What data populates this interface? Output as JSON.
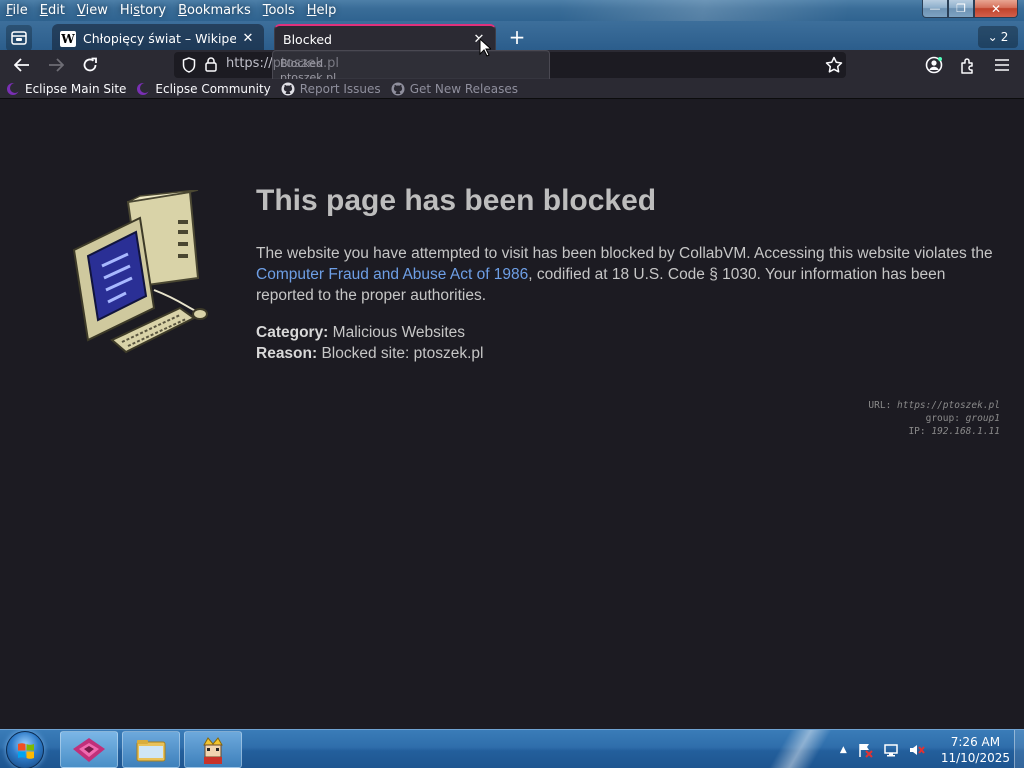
{
  "menu": {
    "file": {
      "u": "F",
      "rest": "ile"
    },
    "edit": {
      "u": "E",
      "rest": "dit"
    },
    "view": {
      "u": "V",
      "rest": "iew"
    },
    "history": {
      "pre": "Hi",
      "u": "s",
      "rest": "tory"
    },
    "bookmarks": {
      "u": "B",
      "rest": "ookmarks"
    },
    "tools": {
      "u": "T",
      "rest": "ools"
    },
    "help": {
      "u": "H",
      "rest": "elp"
    }
  },
  "window_controls": {
    "minimize": "—",
    "maximize": "❐",
    "close": "✕"
  },
  "tabs": [
    {
      "title": "Chłopięcy świat – Wikipedia, wo",
      "favicon": "W",
      "close": "✕",
      "active": false
    },
    {
      "title": "Blocked",
      "close": "✕",
      "active": true
    }
  ],
  "new_tab_label": "+",
  "tab_list_count": "2",
  "urlbar": {
    "url": "https://ptoszek.pl"
  },
  "url_popup": {
    "line1": "Blocked",
    "line2": "ptoszek.pl"
  },
  "bookmarks": [
    {
      "label": "Eclipse Main Site",
      "icon": "eclipse-icon",
      "dim": false
    },
    {
      "label": "Eclipse Community",
      "icon": "eclipse-icon",
      "dim": false
    },
    {
      "label": "Report Issues",
      "icon": "github-icon",
      "dim": true
    },
    {
      "label": "Get New Releases",
      "icon": "github-icon",
      "dim": true
    }
  ],
  "page": {
    "title": "This page has been blocked",
    "message_before": "The website you have attempted to visit has been blocked by CollabVM. Accessing this website violates the ",
    "message_link": "Computer Fraud and Abuse Act of 1986",
    "message_after": ", codified at 18 U.S. Code § 1030. Your information has been reported to the proper authorities.",
    "category_label": "Category:",
    "category_value": "Malicious Websites",
    "reason_label": "Reason:",
    "reason_value": "Blocked site: ptoszek.pl",
    "debug": {
      "url_label": "URL:",
      "url_value": "https://ptoszek.pl",
      "group_label": "group:",
      "group_value": "group1",
      "ip_label": "IP:",
      "ip_value": "192.168.1.11"
    }
  },
  "taskbar": {
    "clock_time": "7:26 AM",
    "clock_date": "11/10/2025",
    "tray_arrow": "▲"
  },
  "colors": {
    "accent_tab": "#e0317c",
    "link": "#6e9fe6",
    "page_bg": "#1c1b22"
  }
}
